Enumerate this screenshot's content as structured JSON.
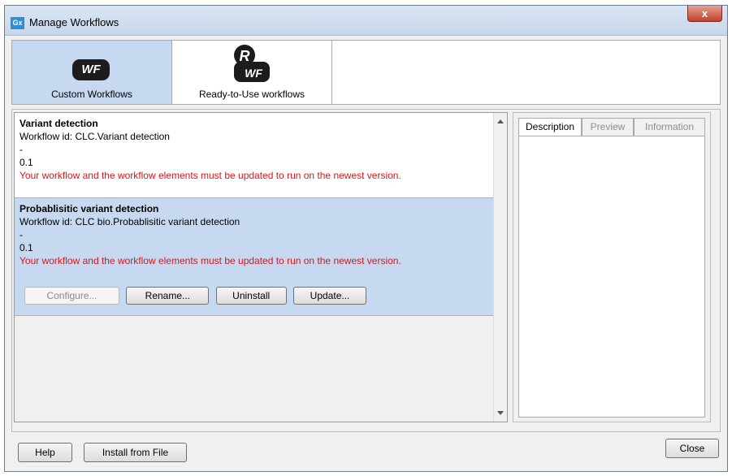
{
  "window": {
    "title": "Manage Workflows",
    "close_symbol": "x",
    "app_icon_text": "Gx"
  },
  "category_tabs": [
    {
      "label": "Custom Workflows",
      "icon": "wf-icon",
      "badge_text": "WF"
    },
    {
      "label": "Ready-to-Use workflows",
      "icon": "ready-to-use-wf-icon",
      "badge_r": "R",
      "badge_wf": "WF"
    }
  ],
  "workflows": [
    {
      "name": "Variant detection",
      "id_line": "Workflow id: CLC.Variant detection",
      "dash": "-",
      "version": "0.1",
      "warning": "Your workflow and the workflow elements must be updated to run on the newest version."
    },
    {
      "name": "Probablisitic variant detection",
      "id_line": "Workflow id: CLC bio.Probablisitic variant detection",
      "dash": "-",
      "version": "0.1",
      "warning": "Your workflow and the workflow elements must be updated to run on the newest version.",
      "buttons": {
        "configure": "Configure...",
        "rename": "Rename...",
        "uninstall": "Uninstall",
        "update": "Update..."
      }
    }
  ],
  "side_tabs": [
    "Description",
    "Preview",
    "Information"
  ],
  "footer": {
    "help": "Help",
    "install": "Install from File",
    "close": "Close"
  },
  "colors": {
    "selected_bg": "#c6d9f0",
    "warning": "#d8161b",
    "close_red": "#c2412b"
  }
}
